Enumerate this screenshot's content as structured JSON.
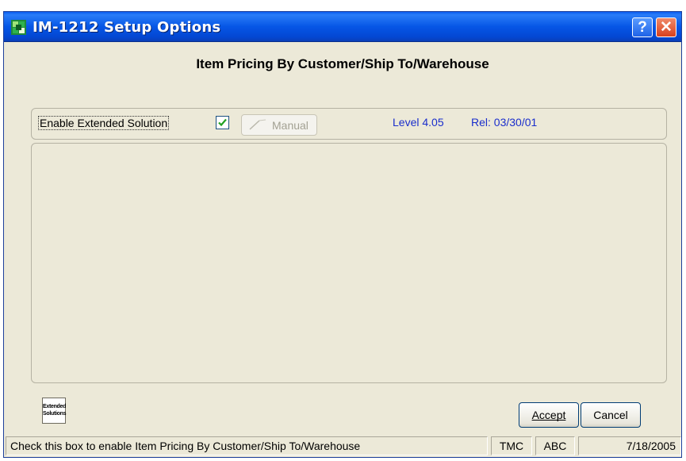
{
  "window": {
    "title": "IM-1212 Setup Options",
    "app_icon": "app-icon",
    "help_glyph": "?",
    "close_glyph": "✕"
  },
  "heading": "Item Pricing By Customer/Ship To/Warehouse",
  "top_panel": {
    "enable_label": "Enable Extended Solution",
    "enable_checked": true,
    "manual_label": "Manual",
    "manual_icon": "wand-icon",
    "level": "Level 4.05",
    "release": "Rel: 03/30/01"
  },
  "logo": {
    "line1": "Extended",
    "line2": "Solutions"
  },
  "buttons": {
    "accept": "Accept",
    "cancel": "Cancel"
  },
  "status_bar": {
    "message": "Check this box to enable Item Pricing By Customer/Ship To/Warehouse",
    "company1": "TMC",
    "company2": "ABC",
    "date": "7/18/2005"
  },
  "colors": {
    "title_blue": "#0656e6",
    "dialog_bg": "#ece9d8",
    "info_text_blue": "#1a2ecc",
    "close_red": "#d8411e"
  }
}
